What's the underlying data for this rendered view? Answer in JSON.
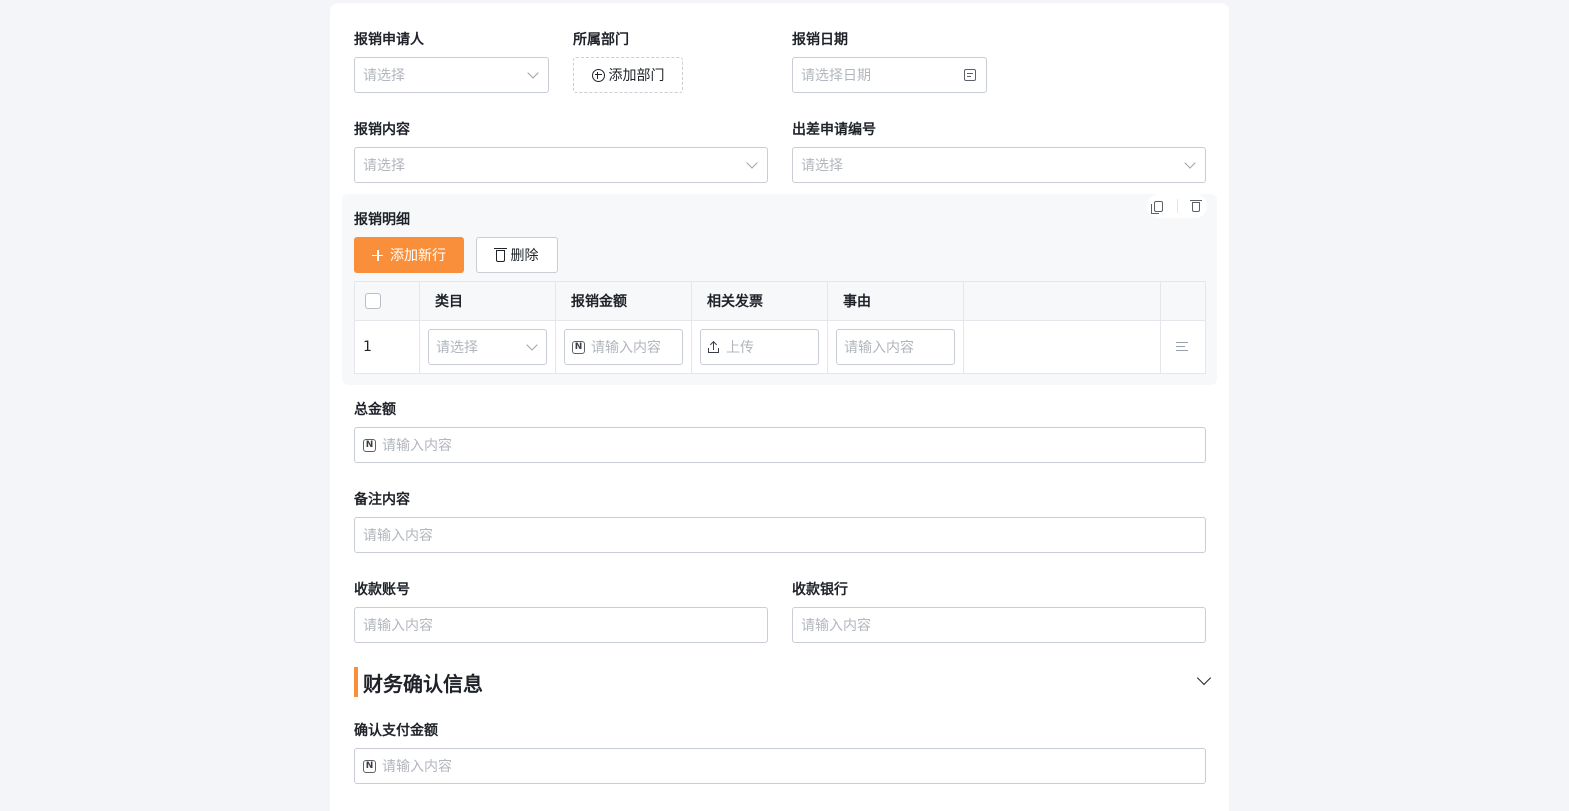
{
  "form": {
    "applicant": {
      "label": "报销申请人",
      "placeholder": "请选择"
    },
    "department": {
      "label": "所属部门",
      "add_label": "添加部门"
    },
    "date": {
      "label": "报销日期",
      "placeholder": "请选择日期"
    },
    "content": {
      "label": "报销内容",
      "placeholder": "请选择"
    },
    "trip_no": {
      "label": "出差申请编号",
      "placeholder": "请选择"
    },
    "details": {
      "label": "报销明细",
      "add_row_label": "添加新行",
      "delete_label": "删除",
      "columns": [
        "类目",
        "报销金额",
        "相关发票",
        "事由"
      ],
      "rows": [
        {
          "index": "1",
          "category_placeholder": "请选择",
          "amount_placeholder": "请输入内容",
          "invoice_label": "上传",
          "reason_placeholder": "请输入内容"
        }
      ]
    },
    "total": {
      "label": "总金额",
      "placeholder": "请输入内容"
    },
    "remark": {
      "label": "备注内容",
      "placeholder": "请输入内容"
    },
    "account": {
      "label": "收款账号",
      "placeholder": "请输入内容"
    },
    "bank": {
      "label": "收款银行",
      "placeholder": "请输入内容"
    }
  },
  "finance": {
    "title": "财务确认信息",
    "confirm_amount": {
      "label": "确认支付金额",
      "placeholder": "请输入内容"
    }
  },
  "colors": {
    "accent": "#f98f3a",
    "border": "#c9cdd4",
    "placeholder": "#b2b6bd",
    "background": "#f3f5f8"
  },
  "icons": [
    "chevron-down-icon",
    "calendar-icon",
    "plus-circle-icon",
    "plus-icon",
    "trash-icon",
    "copy-icon",
    "number-icon",
    "upload-icon",
    "row-settings-icon"
  ]
}
